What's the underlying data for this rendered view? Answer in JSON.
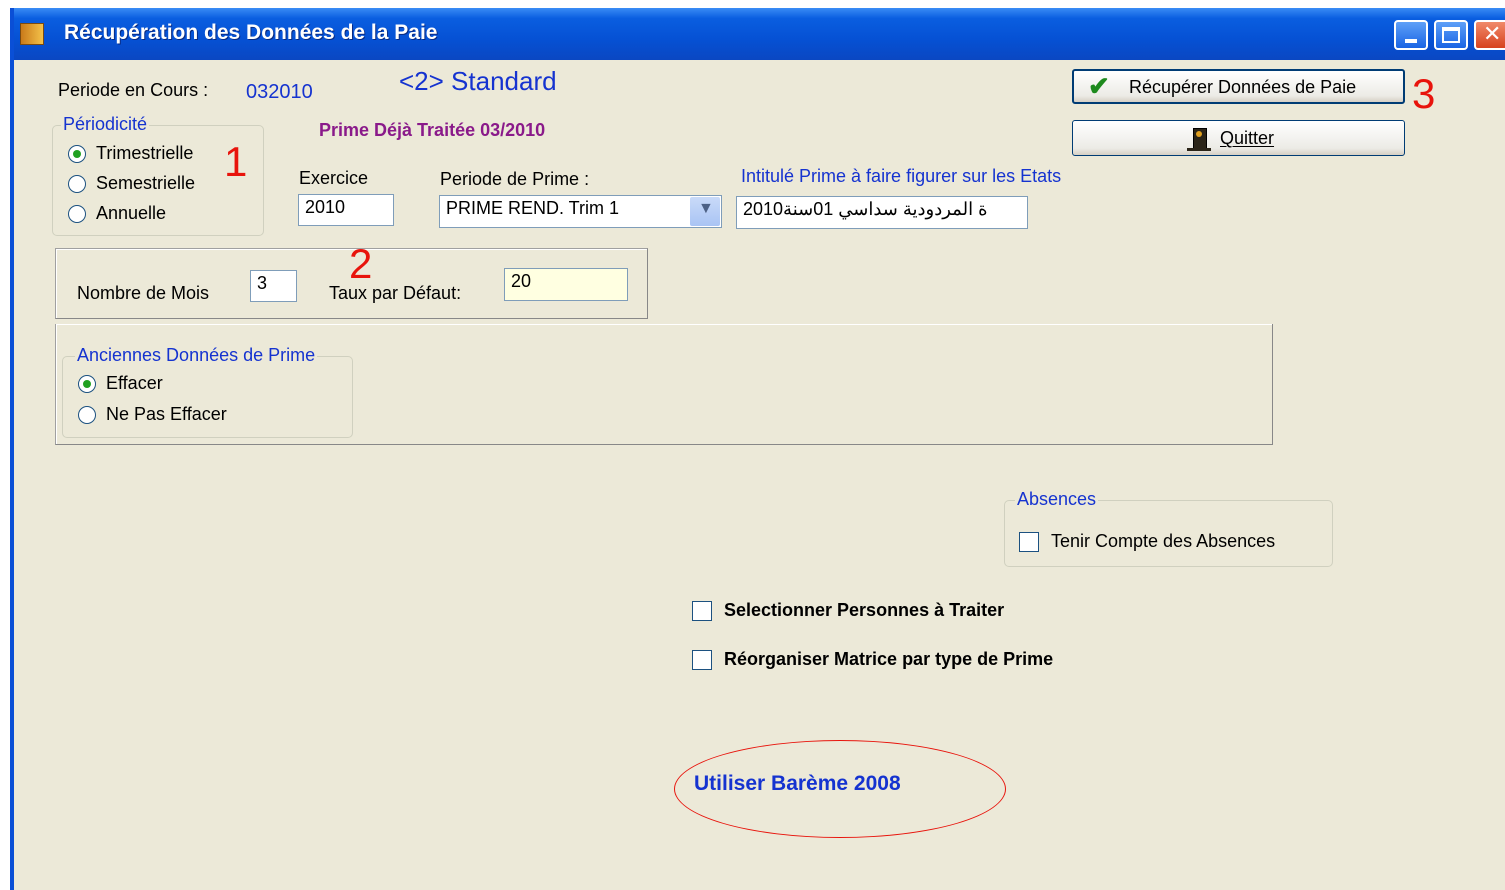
{
  "window": {
    "title": "Récupération des Données de la Paie"
  },
  "header": {
    "periode_label": "Periode en Cours :",
    "periode_value": "032010",
    "mode": "<2> Standard",
    "prime_traitee": "Prime Déjà Traitée 03/2010"
  },
  "periodicite": {
    "legend": "Périodicité",
    "options": [
      "Trimestrielle",
      "Semestrielle",
      "Annuelle"
    ],
    "selected": "Trimestrielle"
  },
  "exercice": {
    "label": "Exercice",
    "value": "2010"
  },
  "periode_prime": {
    "label": "Periode de Prime :",
    "value": "PRIME REND. Trim 1"
  },
  "intitule": {
    "label": "Intitulé Prime à faire figurer sur les Etats",
    "value": "ة المردودية سداسي 01سنة2010"
  },
  "mois": {
    "label": "Nombre de Mois",
    "value": "3"
  },
  "taux": {
    "label": "Taux par Défaut:",
    "value": "20"
  },
  "anciennes": {
    "legend": "Anciennes Données de Prime",
    "options": [
      "Effacer",
      "Ne Pas Effacer"
    ],
    "selected": "Effacer"
  },
  "buttons": {
    "recuperer": "Récupérer Données de Paie",
    "quitter": "Quitter"
  },
  "absences": {
    "legend": "Absences",
    "checkbox": "Tenir Compte des Absences"
  },
  "options": {
    "selectionner": "Selectionner Personnes à Traiter",
    "reorganiser": "Réorganiser Matrice par type de Prime"
  },
  "bareme": "Utiliser Barème 2008",
  "annotations": [
    "1",
    "2",
    "3"
  ],
  "colors": {
    "titlebar": "#0651d4",
    "annotation": "#e8140c",
    "accent_blue": "#1533d0",
    "prime": "#8a1a8a"
  }
}
